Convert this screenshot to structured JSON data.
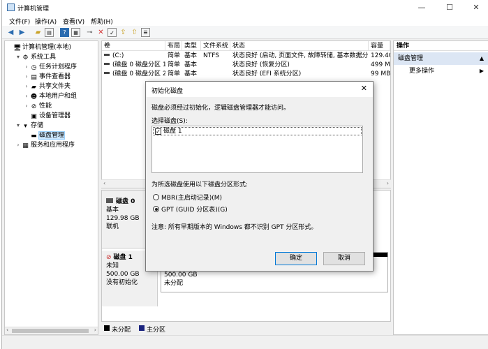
{
  "window": {
    "title": "计算机管理",
    "controls": {
      "minimize": "—",
      "maximize": "☐",
      "close": "✕"
    }
  },
  "menu": [
    {
      "label": "文件(F)"
    },
    {
      "label": "操作(A)"
    },
    {
      "label": "查看(V)"
    },
    {
      "label": "帮助(H)"
    }
  ],
  "tree": {
    "items": [
      {
        "label": "计算机管理(本地)",
        "icon": "computer-icon",
        "glyph": "🖥",
        "level": 0,
        "exp": ""
      },
      {
        "label": "系统工具",
        "icon": "tools-icon",
        "glyph": "⚙",
        "level": 1,
        "exp": "▾"
      },
      {
        "label": "任务计划程序",
        "icon": "clock-icon",
        "glyph": "◷",
        "level": 2,
        "exp": "›"
      },
      {
        "label": "事件查看器",
        "icon": "event-log-icon",
        "glyph": "▤",
        "level": 2,
        "exp": "›"
      },
      {
        "label": "共享文件夹",
        "icon": "folder-icon",
        "glyph": "▰",
        "level": 2,
        "exp": "›"
      },
      {
        "label": "本地用户和组",
        "icon": "users-icon",
        "glyph": "☻",
        "level": 2,
        "exp": "›"
      },
      {
        "label": "性能",
        "icon": "no-entry-icon",
        "glyph": "⊘",
        "level": 2,
        "exp": "›"
      },
      {
        "label": "设备管理器",
        "icon": "device-icon",
        "glyph": "▣",
        "level": 2,
        "exp": ""
      },
      {
        "label": "存储",
        "icon": "storage-icon",
        "glyph": "▾",
        "level": 1,
        "exp": "▾"
      },
      {
        "label": "磁盘管理",
        "icon": "disk-icon",
        "glyph": "▬",
        "level": 2,
        "exp": "",
        "selected": true
      },
      {
        "label": "服务和应用程序",
        "icon": "services-icon",
        "glyph": "▦",
        "level": 1,
        "exp": "›"
      }
    ]
  },
  "volumes": {
    "columns": [
      "卷",
      "布局",
      "类型",
      "文件系统",
      "状态",
      "容量"
    ],
    "rows": [
      {
        "vol": "(C:)",
        "layout": "简单",
        "type": "基本",
        "fs": "NTFS",
        "status": "状态良好 (启动, 页面文件, 故障转储, 基本数据分区)",
        "size": "129.40"
      },
      {
        "vol": "(磁盘 0 磁盘分区 1)",
        "layout": "简单",
        "type": "基本",
        "fs": "",
        "status": "状态良好 (恢复分区)",
        "size": "499 MB"
      },
      {
        "vol": "(磁盘 0 磁盘分区 2)",
        "layout": "简单",
        "type": "基本",
        "fs": "",
        "status": "状态良好 (EFI 系统分区)",
        "size": "99 MB"
      }
    ]
  },
  "disks": [
    {
      "name": "磁盘 0",
      "type": "基本",
      "size": "129.98 GB",
      "state": "联机"
    },
    {
      "name": "磁盘 1",
      "type": "未知",
      "size": "500.00 GB",
      "state": "没有初始化",
      "part_size": "500.00 GB",
      "part_state": "未分配"
    }
  ],
  "legend": {
    "unallocated": "未分配",
    "primary": "主分区"
  },
  "actions": {
    "header": "操作",
    "section": "磁盘管理",
    "more": "更多操作"
  },
  "dialog": {
    "title": "初始化磁盘",
    "message": "磁盘必须经过初始化，逻辑磁盘管理器才能访问。",
    "select_label": "选择磁盘(S):",
    "disk_item": "磁盘 1",
    "style_label": "为所选磁盘使用以下磁盘分区形式:",
    "mbr_label": "MBR(主启动记录)(M)",
    "gpt_label": "GPT (GUID 分区表)(G)",
    "note": "注意: 所有早期版本的 Windows 都不识别 GPT 分区形式。",
    "ok": "确定",
    "cancel": "取消"
  },
  "colors": {
    "unallocated": "#000000",
    "primary": "#1a237e",
    "selection": "#cce8ff"
  }
}
